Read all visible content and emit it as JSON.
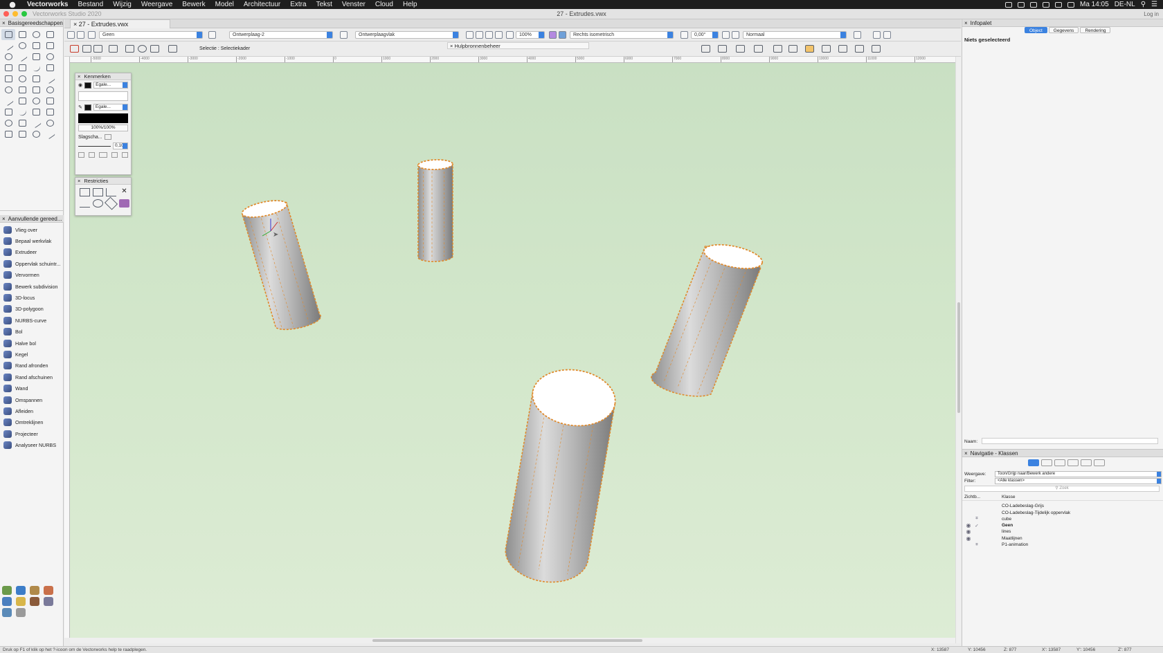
{
  "menubar": {
    "app": "Vectorworks",
    "items": [
      "Bestand",
      "Wijzig",
      "Weergave",
      "Bewerk",
      "Model",
      "Architectuur",
      "Extra",
      "Tekst",
      "Venster",
      "Cloud",
      "Help"
    ],
    "clock": "Ma 14:05",
    "locale": "DE-NL"
  },
  "window": {
    "title": "27 - Extrudes.vwx",
    "app_name": "Vectorworks Studio 2020",
    "login": "Log in"
  },
  "doc_tab": "27 - Extrudes.vwx",
  "viewbar": {
    "klasse": "Geen",
    "laag": "Ontwerplaag-2",
    "werkvlak": "Ontwerplaagvlak",
    "zoom": "100%",
    "aanzicht": "Rechts isometrisch",
    "rotatie": "0,00°",
    "render": "Normaal"
  },
  "modebar": {
    "mode_label": "Selectie : Selectiekader",
    "helper_title": "Hulpbronnenbeheer"
  },
  "ruler_ticks": [
    "-5000",
    "-4000",
    "-3000",
    "-2000",
    "-1000",
    "0",
    "1000",
    "2000",
    "3000",
    "4000",
    "5000",
    "6000",
    "7000",
    "8000",
    "9000",
    "10000",
    "11000",
    "12000"
  ],
  "left_panel": {
    "title": "Basisgereedschappen",
    "extra_title": "Aanvullende gereed...",
    "extra_items": [
      "Vlieg over",
      "Bepaal werkvlak",
      "Extrudeer",
      "Oppervlak schuintr...",
      "Vervormen",
      "Bewerk subdivision",
      "3D-locus",
      "3D-polygoon",
      "NURBS-curve",
      "Bol",
      "Halve bol",
      "Kegel",
      "Rand afronden",
      "Rand afschuinen",
      "Wand",
      "Omspannen",
      "Afleiden",
      "Omtreklijnen",
      "Projecteer",
      "Analyseer NURBS"
    ]
  },
  "kenmerken": {
    "title": "Kenmerken",
    "fill_style": "Egale...",
    "pen_style": "Egale...",
    "opacity": "100%/100%",
    "shadow_label": "Slagscha...",
    "line_weight": "0,10"
  },
  "restricties": {
    "title": "Restricties"
  },
  "infopalet": {
    "title": "Infopalet",
    "tabs": [
      "Object",
      "Gegevens",
      "Rendering"
    ],
    "nothing_selected": "Niets geselecteerd",
    "naam_label": "Naam:"
  },
  "navigatie": {
    "title": "Navigatie - Klassen",
    "weergave_label": "Weergave:",
    "weergave_value": "Toon/Grijp naar/Bewerk andere",
    "filter_label": "Filter:",
    "filter_value": "<Alle klassen>",
    "search_placeholder": "Zoek",
    "col_visibility": "Zichtb...",
    "col_class": "Klasse",
    "classes": [
      "CO-Ladebeslag-Grijs",
      "CO-Ladebeslag-Tijdelijk oppervlak",
      "cube",
      "Geen",
      "lines",
      "Maatlijnen",
      "P1-animation"
    ]
  },
  "status": {
    "hint": "Druk op F1 of klik op het ?-icoon om de Vectorworks help te raadplegen.",
    "coords": [
      "X: 13587",
      "Y: 10456",
      "Z: 877",
      "X': 13587",
      "Y': 10456",
      "Z': 877"
    ]
  },
  "colors": {
    "accent": "#3b82e0",
    "canvas": "#d3e7cb",
    "selection_outline": "#e08a2c"
  }
}
